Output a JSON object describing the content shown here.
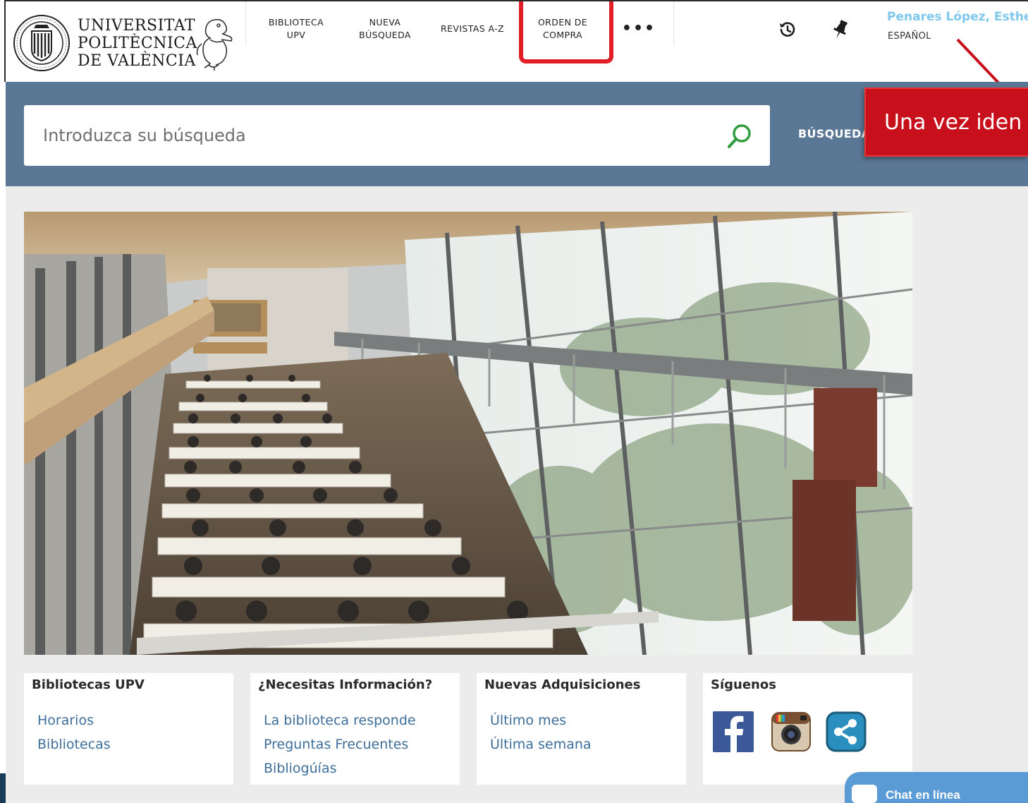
{
  "logo": {
    "line1": "UNIVERSITAT",
    "line2": "POLITÈCNICA",
    "line3": "DE VALÈNCIA"
  },
  "nav": {
    "biblioteca": "BIBLIOTECA\nUPV",
    "nueva_busqueda": "NUEVA\nBÚSQUEDA",
    "revistas": "REVISTAS A-Z",
    "orden_compra": "ORDEN DE\nCOMPRA",
    "more": "•••"
  },
  "user": {
    "name": "Penares López, Esther",
    "language": "ESPAÑOL"
  },
  "search": {
    "placeholder": "Introduzca su búsqueda",
    "advanced_label": "BÚSQUEDA"
  },
  "callout": {
    "text": "Una vez iden"
  },
  "cards": {
    "bibliotecas": {
      "title": "Bibliotecas UPV",
      "links": [
        "Horarios",
        "Bibliotecas"
      ]
    },
    "informacion": {
      "title": "¿Necesitas Información?",
      "links": [
        "La biblioteca responde",
        "Preguntas Frecuentes",
        "Bibliogúías"
      ]
    },
    "adquisiciones": {
      "title": "Nuevas Adquisiciones",
      "links": [
        "Último mes",
        "Última semana"
      ]
    },
    "siguenos": {
      "title": "Síguenos"
    }
  },
  "chat": {
    "label": "Chat en línea"
  },
  "colors": {
    "search_band": "#5a7896",
    "link": "#3d6e9c",
    "highlight": "#e11d26",
    "callout": "#c8101c",
    "user_name": "#7ec8ee"
  }
}
